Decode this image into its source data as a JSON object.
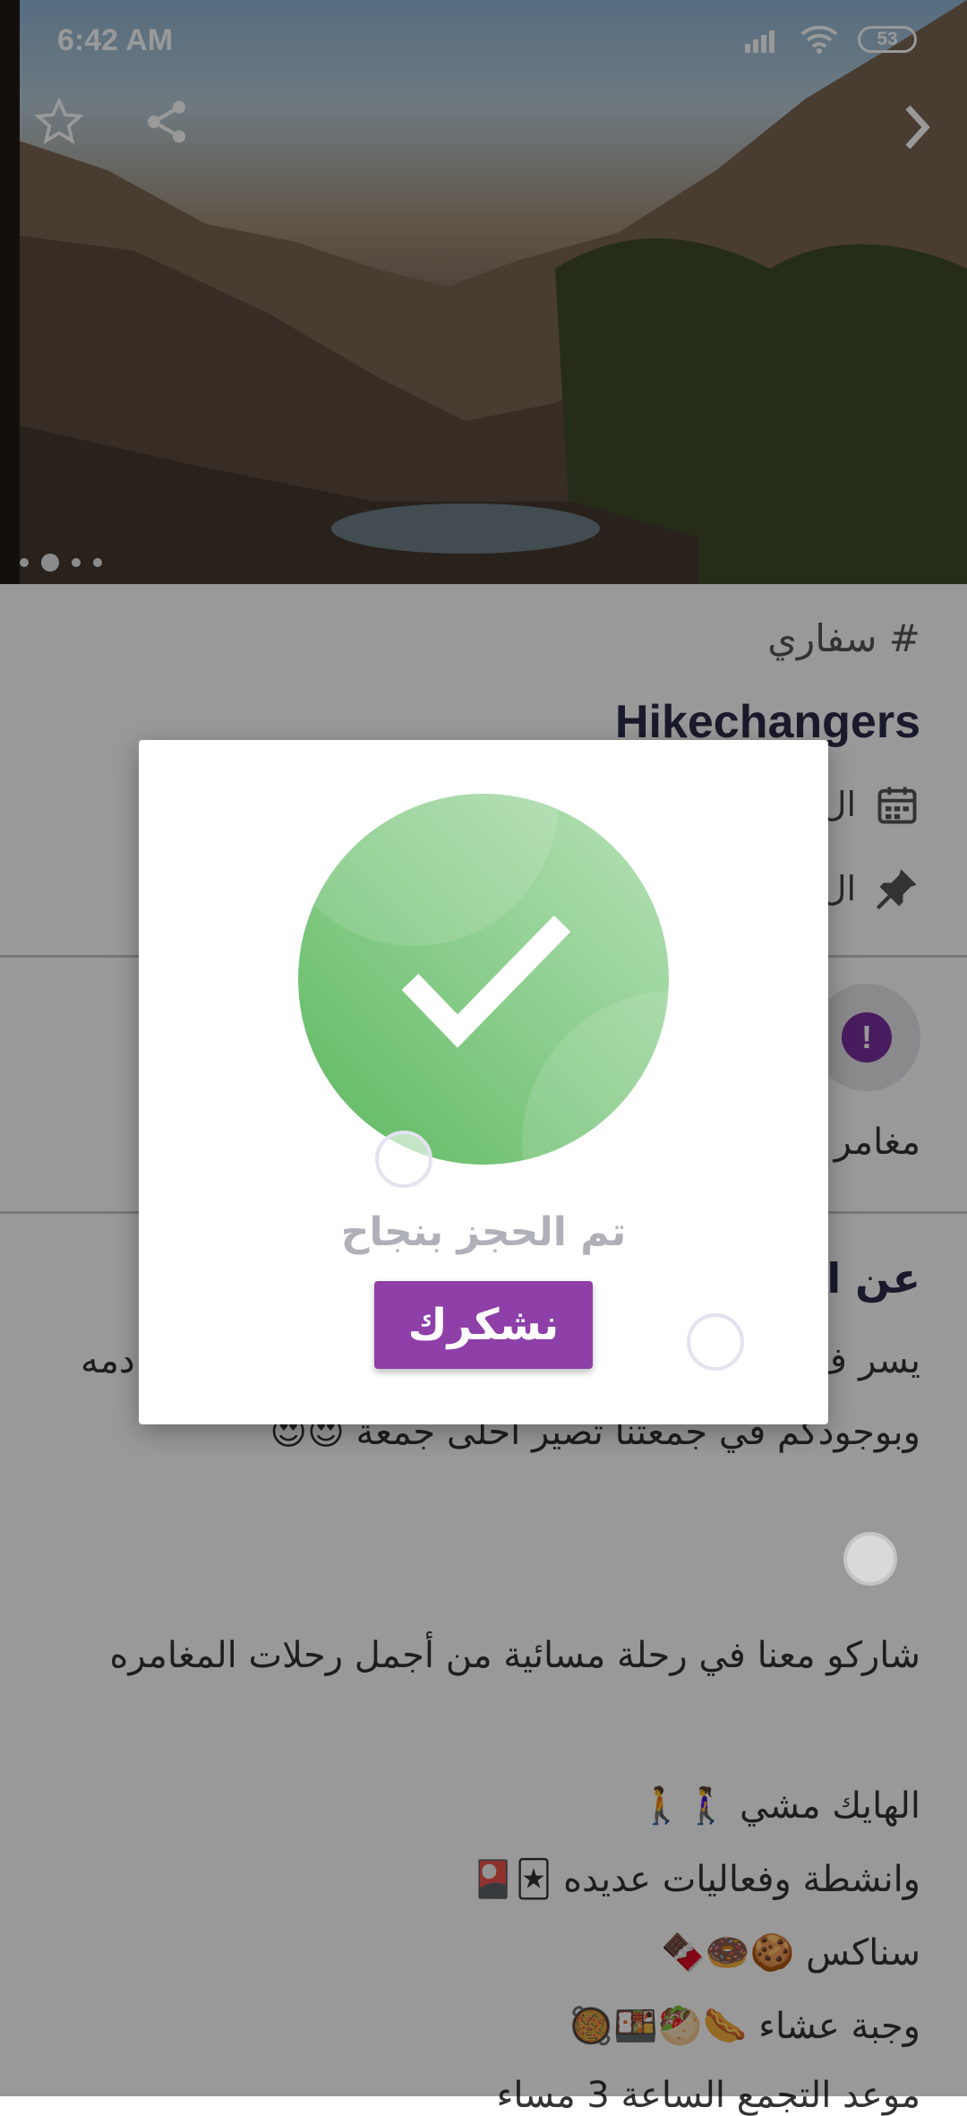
{
  "status_bar": {
    "time": "6:42 AM",
    "battery": "53"
  },
  "hero": {
    "carousel_count": 4,
    "active_index": 1
  },
  "content": {
    "tag": "# سفاري",
    "title": "Hikechangers",
    "date_label": "ال",
    "location_label": "ال",
    "info_label": "مغامر",
    "about_heading": "عن ال",
    "about_line1": "يسر ف",
    "about_line1_end": "دمه",
    "about_line2": "وبوجودكم في جمعتنا تصير احلى جمعة 😍😍",
    "body_paragraph": "شاركو معنا في رحلة مسائية من أجمل رحلات المغامره",
    "list_items": [
      "الهايك مشي 🚶‍♀️🚶",
      "وانشطة وفعاليات عديده 🃏🎴",
      "سناكس 🍪🍩🍫",
      "وجبة عشاء 🌭🥙🍱🥘"
    ],
    "bottom_cut": "موعد التجمع الساعة 3 مساء"
  },
  "dialog": {
    "message": "تم الحجز بنجاح",
    "button_label": "نشكرك",
    "accent_color": "#8e3fa8",
    "success_color": "#66bb6a"
  },
  "icons": {
    "star": "star-outline-icon",
    "share": "share-icon",
    "next": "chevron-right-icon",
    "calendar": "calendar-icon",
    "pin": "pin-icon",
    "warning": "exclamation-icon",
    "check": "checkmark-icon"
  }
}
